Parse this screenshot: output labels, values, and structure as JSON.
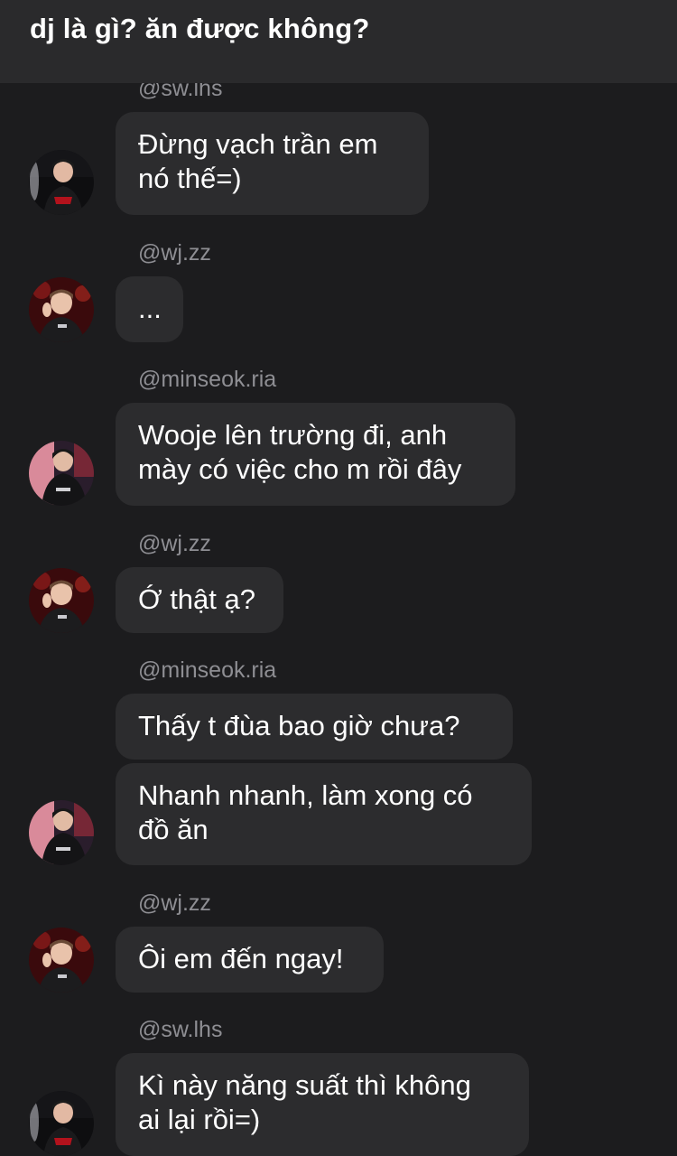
{
  "header": {
    "title": "dj là gì? ăn được không?"
  },
  "messages": [
    {
      "username": "@sw.lhs",
      "avatar": "sw-lhs-avatar",
      "bubbles": [
        "Đừng vạch trần em\nnó thế=)"
      ]
    },
    {
      "username": "@wj.zz",
      "avatar": "wj-zz-avatar",
      "bubbles": [
        "..."
      ]
    },
    {
      "username": "@minseok.ria",
      "avatar": "minseok-ria-avatar",
      "bubbles": [
        "Wooje lên trường đi, anh\nmày có việc cho m rồi đây"
      ]
    },
    {
      "username": "@wj.zz",
      "avatar": "wj-zz-avatar",
      "bubbles": [
        "Ớ thật ạ?"
      ]
    },
    {
      "username": "@minseok.ria",
      "avatar": "minseok-ria-avatar",
      "bubbles": [
        "Thấy t đùa bao giờ chưa?",
        "Nhanh nhanh, làm xong có\nđồ ăn"
      ]
    },
    {
      "username": "@wj.zz",
      "avatar": "wj-zz-avatar",
      "bubbles": [
        "Ôi em đến ngay!"
      ]
    },
    {
      "username": "@sw.lhs",
      "avatar": "sw-lhs-avatar",
      "bubbles": [
        "Kì này năng suất thì không\nai lại rồi=)"
      ]
    }
  ],
  "colors": {
    "background": "#1c1c1e",
    "header": "#2a2a2c",
    "bubble": "#2c2c2e",
    "username": "#8e8e93"
  }
}
